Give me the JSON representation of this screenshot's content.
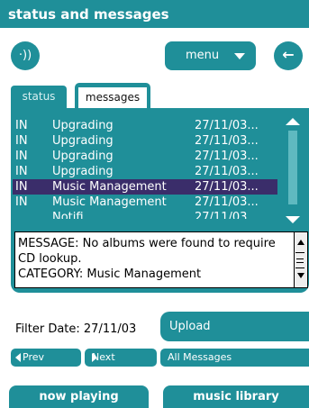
{
  "window": {
    "title": "status and messages"
  },
  "toolbar": {
    "speaker_icon": "speaker-icon",
    "speaker_glyph": "·))",
    "menu_label": "menu",
    "back_icon": "back-arrow-icon",
    "back_glyph": "←"
  },
  "tabs": [
    {
      "label": "status",
      "selected": false
    },
    {
      "label": "messages",
      "selected": true
    }
  ],
  "messages": [
    {
      "type": "IN",
      "title": "Upgrading",
      "date": "27/11/03..."
    },
    {
      "type": "IN",
      "title": "Upgrading",
      "date": "27/11/03..."
    },
    {
      "type": "IN",
      "title": "Upgrading",
      "date": "27/11/03..."
    },
    {
      "type": "IN",
      "title": "Upgrading",
      "date": "27/11/03..."
    },
    {
      "type": "IN",
      "title": "Music Management",
      "date": "27/11/03...",
      "selected": true
    },
    {
      "type": "IN",
      "title": "Music Management",
      "date": "27/11/03..."
    },
    {
      "type": "",
      "title": "Notifi",
      "date": "27/11/03..."
    }
  ],
  "detail": {
    "text_lines": [
      "MESSAGE: No albums were found to require",
      "CD lookup.",
      "CATEGORY: Music Management"
    ]
  },
  "filter": {
    "label": "Filter Date: 27/11/03"
  },
  "buttons": {
    "upload": "Upload",
    "prev": "Prev",
    "next": "Next",
    "all_messages": "All Messages",
    "now_playing": "now playing",
    "music_library": "music library"
  },
  "colors": {
    "accent": "#1f8f99",
    "selection": "#3a2d6a"
  }
}
